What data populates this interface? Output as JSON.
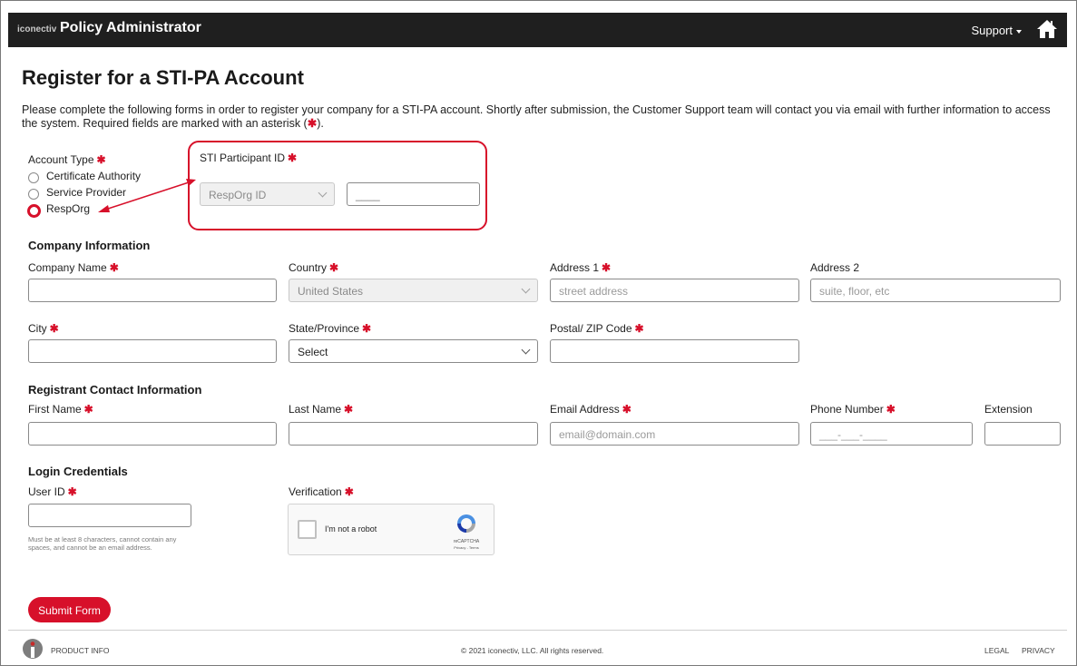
{
  "header": {
    "brand_small": "iconectiv",
    "brand": "Policy Administrator",
    "support_label": "Support",
    "icons": [
      "home-icon",
      "chevron-down-icon"
    ]
  },
  "page": {
    "title": "Register for a STI-PA Account",
    "intro": "Please complete the following forms in order to register your company for a STI-PA account. Shortly after submission, the Customer Support team will contact you via email with further information to access the system. Required fields are marked with an asterisk (",
    "intro_end": ").",
    "required_mark": "✱"
  },
  "account_type": {
    "label": "Account Type",
    "options": [
      "Certificate Authority",
      "Service Provider",
      "RespOrg"
    ],
    "selected": "RespOrg"
  },
  "participant": {
    "label": "STI Participant ID",
    "type_value": "RespOrg ID",
    "id_placeholder": "____"
  },
  "company": {
    "heading": "Company Information",
    "name_label": "Company Name",
    "country_label": "Country",
    "country_value": "United States",
    "address1_label": "Address 1",
    "address1_placeholder": "street address",
    "address2_label": "Address 2",
    "address2_placeholder": "suite, floor, etc",
    "city_label": "City",
    "state_label": "State/Province",
    "state_value": "Select",
    "zip_label": "Postal/ ZIP Code"
  },
  "contact": {
    "heading": "Registrant Contact Information",
    "first_label": "First Name",
    "last_label": "Last Name",
    "email_label": "Email Address",
    "email_placeholder": "email@domain.com",
    "phone_label": "Phone Number",
    "phone_placeholder": "___-___-____",
    "ext_label": "Extension"
  },
  "login": {
    "heading": "Login Credentials",
    "userid_label": "User ID",
    "userid_hint": "Must be at least 8 characters, cannot contain any spaces, and cannot be an email address.",
    "verification_label": "Verification",
    "captcha_text": "I'm not a robot",
    "captcha_brand": "reCAPTCHA",
    "captcha_terms": "Privacy - Terms"
  },
  "actions": {
    "submit_label": "Submit Form"
  },
  "footer": {
    "product_info": "PRODUCT INFO",
    "copyright": "© 2021 iconectiv, LLC. All rights reserved.",
    "legal": "LEGAL",
    "privacy": "PRIVACY"
  },
  "colors": {
    "accent": "#d7102a",
    "topbar": "#1f1f1f"
  }
}
